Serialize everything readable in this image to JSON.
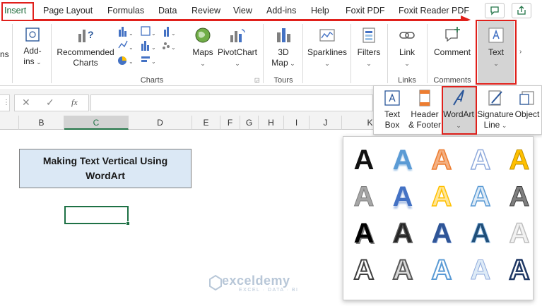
{
  "tabs": [
    {
      "label": "Insert",
      "active": true
    },
    {
      "label": "Page Layout"
    },
    {
      "label": "Formulas"
    },
    {
      "label": "Data"
    },
    {
      "label": "Review"
    },
    {
      "label": "View"
    },
    {
      "label": "Add-ins"
    },
    {
      "label": "Help"
    },
    {
      "label": "Foxit PDF"
    },
    {
      "label": "Foxit Reader PDF"
    }
  ],
  "ribbon": {
    "addins": "Add-\nins",
    "recommended_charts": "Recommended\nCharts",
    "charts_group": "Charts",
    "maps": "Maps",
    "pivotchart": "PivotChart",
    "map3d": "3D\nMap",
    "tours_group": "Tours",
    "sparklines": "Sparklines",
    "filters": "Filters",
    "link": "Link",
    "links_group": "Links",
    "comment": "Comment",
    "comments_group": "Comments",
    "text": "Text"
  },
  "formula_bar": {
    "cancel": "✕",
    "enter": "✓",
    "fx": "fx"
  },
  "columns": [
    "B",
    "C",
    "D",
    "E",
    "F",
    "G",
    "H",
    "I",
    "J",
    "K"
  ],
  "title_cell": {
    "line1": "Making Text Vertical Using",
    "line2": "WordArt"
  },
  "text_panel": {
    "text_box": "Text\nBox",
    "header_footer": "Header\n& Footer",
    "wordart": "WordArt",
    "signature_line": "Signature\nLine",
    "object": "Object"
  },
  "wordart_glyph": "A",
  "watermark": {
    "name": "exceldemy",
    "tagline": "EXCEL · DATA · BI"
  },
  "colors": {
    "excel_green": "#217346",
    "highlight_red": "#e0201b",
    "title_fill": "#dbe8f5"
  }
}
